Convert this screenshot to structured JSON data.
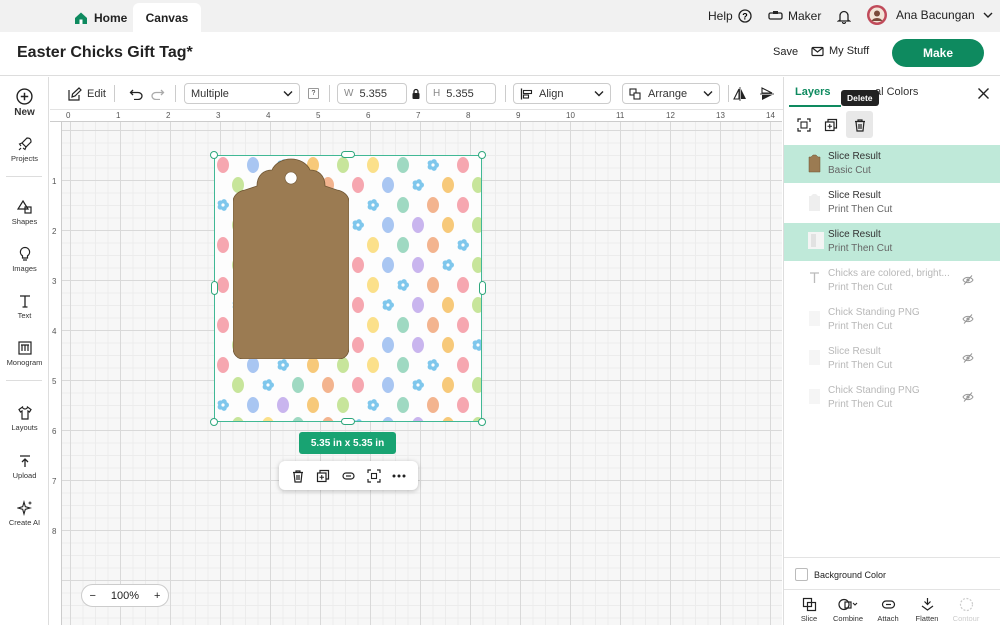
{
  "topnav": {
    "home_label": "Home",
    "canvas_label": "Canvas",
    "help_label": "Help",
    "maker_label": "Maker",
    "user_name": "Ana Bacungan"
  },
  "titlebar": {
    "project_title": "Easter Chicks Gift Tag*",
    "save_label": "Save",
    "mystuff_label": "My Stuff",
    "make_label": "Make"
  },
  "lefttools": [
    {
      "label": "New",
      "icon": "plus-circle-icon"
    },
    {
      "label": "Projects",
      "icon": "rocket-icon"
    },
    {
      "label": "Shapes",
      "icon": "shapes-icon"
    },
    {
      "label": "Images",
      "icon": "lightbulb-icon"
    },
    {
      "label": "Text",
      "icon": "text-T-icon"
    },
    {
      "label": "Monogram",
      "icon": "monogram-icon"
    },
    {
      "label": "Layouts",
      "icon": "tshirt-icon"
    },
    {
      "label": "Upload",
      "icon": "upload-icon"
    },
    {
      "label": "Create AI",
      "icon": "sparkle-icon"
    }
  ],
  "edittoolbar": {
    "edit_label": "Edit",
    "operation_value": "Multiple",
    "help_mark": "?",
    "w_label": "W",
    "w_value": "5.355",
    "h_label": "H",
    "h_value": "5.355",
    "align_label": "Align",
    "arrange_label": "Arrange"
  },
  "ruler": {
    "top": [
      "0",
      "1",
      "2",
      "3",
      "4",
      "5",
      "6",
      "7",
      "8",
      "9",
      "10",
      "11",
      "12",
      "13",
      "14"
    ],
    "left": [
      "1",
      "2",
      "3",
      "4",
      "5",
      "6",
      "7",
      "8"
    ]
  },
  "canvas": {
    "size_badge": "5.35  in x 5.35  in",
    "zoom_value": "100%",
    "zoom_minus": "−",
    "zoom_plus": "+",
    "tag_color": "#9b7b52"
  },
  "panel": {
    "tab_layers": "Layers",
    "tab_colors": "al Colors",
    "tooltip": "Delete",
    "layers": [
      {
        "name": "Slice Result",
        "sub": "Basic Cut",
        "selected": true,
        "hidden": false,
        "thumb": "tag-brown"
      },
      {
        "name": "Slice Result",
        "sub": "Print Then Cut",
        "selected": false,
        "hidden": false,
        "thumb": "tag-light"
      },
      {
        "name": "Slice Result",
        "sub": "Print Then Cut",
        "selected": true,
        "hidden": false,
        "thumb": "pattern-light"
      },
      {
        "name": "Chicks are colored, bright...",
        "sub": "Print Then Cut",
        "selected": false,
        "hidden": true,
        "thumb": "text-T"
      },
      {
        "name": "Chick Standing PNG",
        "sub": "Print Then Cut",
        "selected": false,
        "hidden": true,
        "thumb": "blank"
      },
      {
        "name": "Slice Result",
        "sub": "Print Then Cut",
        "selected": false,
        "hidden": true,
        "thumb": "blank"
      },
      {
        "name": "Chick Standing PNG",
        "sub": "Print Then Cut",
        "selected": false,
        "hidden": true,
        "thumb": "blank"
      }
    ],
    "background_color_label": "Background Color",
    "bottom_tools": [
      {
        "label": "Slice",
        "icon": "slice-icon"
      },
      {
        "label": "Combine",
        "icon": "combine-icon"
      },
      {
        "label": "Attach",
        "icon": "attach-icon"
      },
      {
        "label": "Flatten",
        "icon": "flatten-icon"
      },
      {
        "label": "Contour",
        "icon": "contour-icon"
      }
    ]
  }
}
